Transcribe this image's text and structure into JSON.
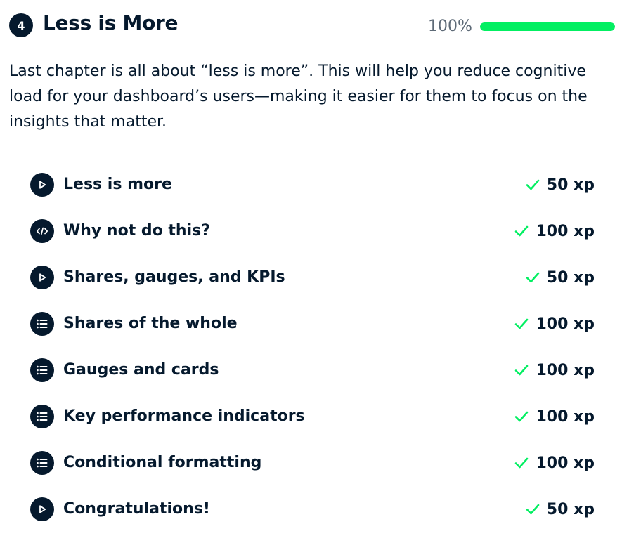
{
  "chapter": {
    "number": "4",
    "title": "Less is More",
    "progress_text": "100%",
    "progress_fraction": 1.0,
    "progress_color": "#03ef62",
    "description": "Last chapter is all about “less is more”. This will help you reduce cognitive load for your dashboard’s users—making it easier for them to focus on the insights that matter."
  },
  "colors": {
    "navy": "#05192d",
    "check": "#03ef62"
  },
  "lessons": [
    {
      "icon": "play-icon",
      "title": "Less is more",
      "xp": "50 xp",
      "completed": true
    },
    {
      "icon": "code-icon",
      "title": "Why not do this?",
      "xp": "100 xp",
      "completed": true
    },
    {
      "icon": "play-icon",
      "title": "Shares, gauges, and KPIs",
      "xp": "50 xp",
      "completed": true
    },
    {
      "icon": "list-icon",
      "title": "Shares of the whole",
      "xp": "100 xp",
      "completed": true
    },
    {
      "icon": "list-icon",
      "title": "Gauges and cards",
      "xp": "100 xp",
      "completed": true
    },
    {
      "icon": "list-icon",
      "title": "Key performance indicators",
      "xp": "100 xp",
      "completed": true
    },
    {
      "icon": "list-icon",
      "title": "Conditional formatting",
      "xp": "100 xp",
      "completed": true
    },
    {
      "icon": "play-icon",
      "title": "Congratulations!",
      "xp": "50 xp",
      "completed": true
    }
  ]
}
